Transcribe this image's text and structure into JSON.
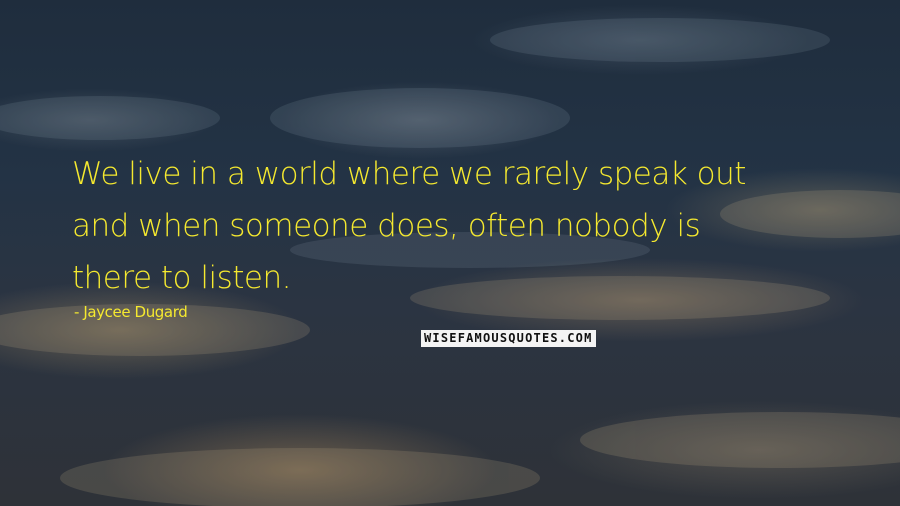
{
  "quote": {
    "lines": [
      "We live in a world where we rarely speak out",
      "and when someone does, often nobody is",
      "there to listen."
    ],
    "author": "- Jaycee Dugard"
  },
  "watermark": {
    "text": "WISEFAMOUSQUOTES.COM"
  },
  "colors": {
    "quote_text": "#f5e92f",
    "sky_dark": "#1f2d3d",
    "watermark_bg": "#f4f4f4"
  }
}
